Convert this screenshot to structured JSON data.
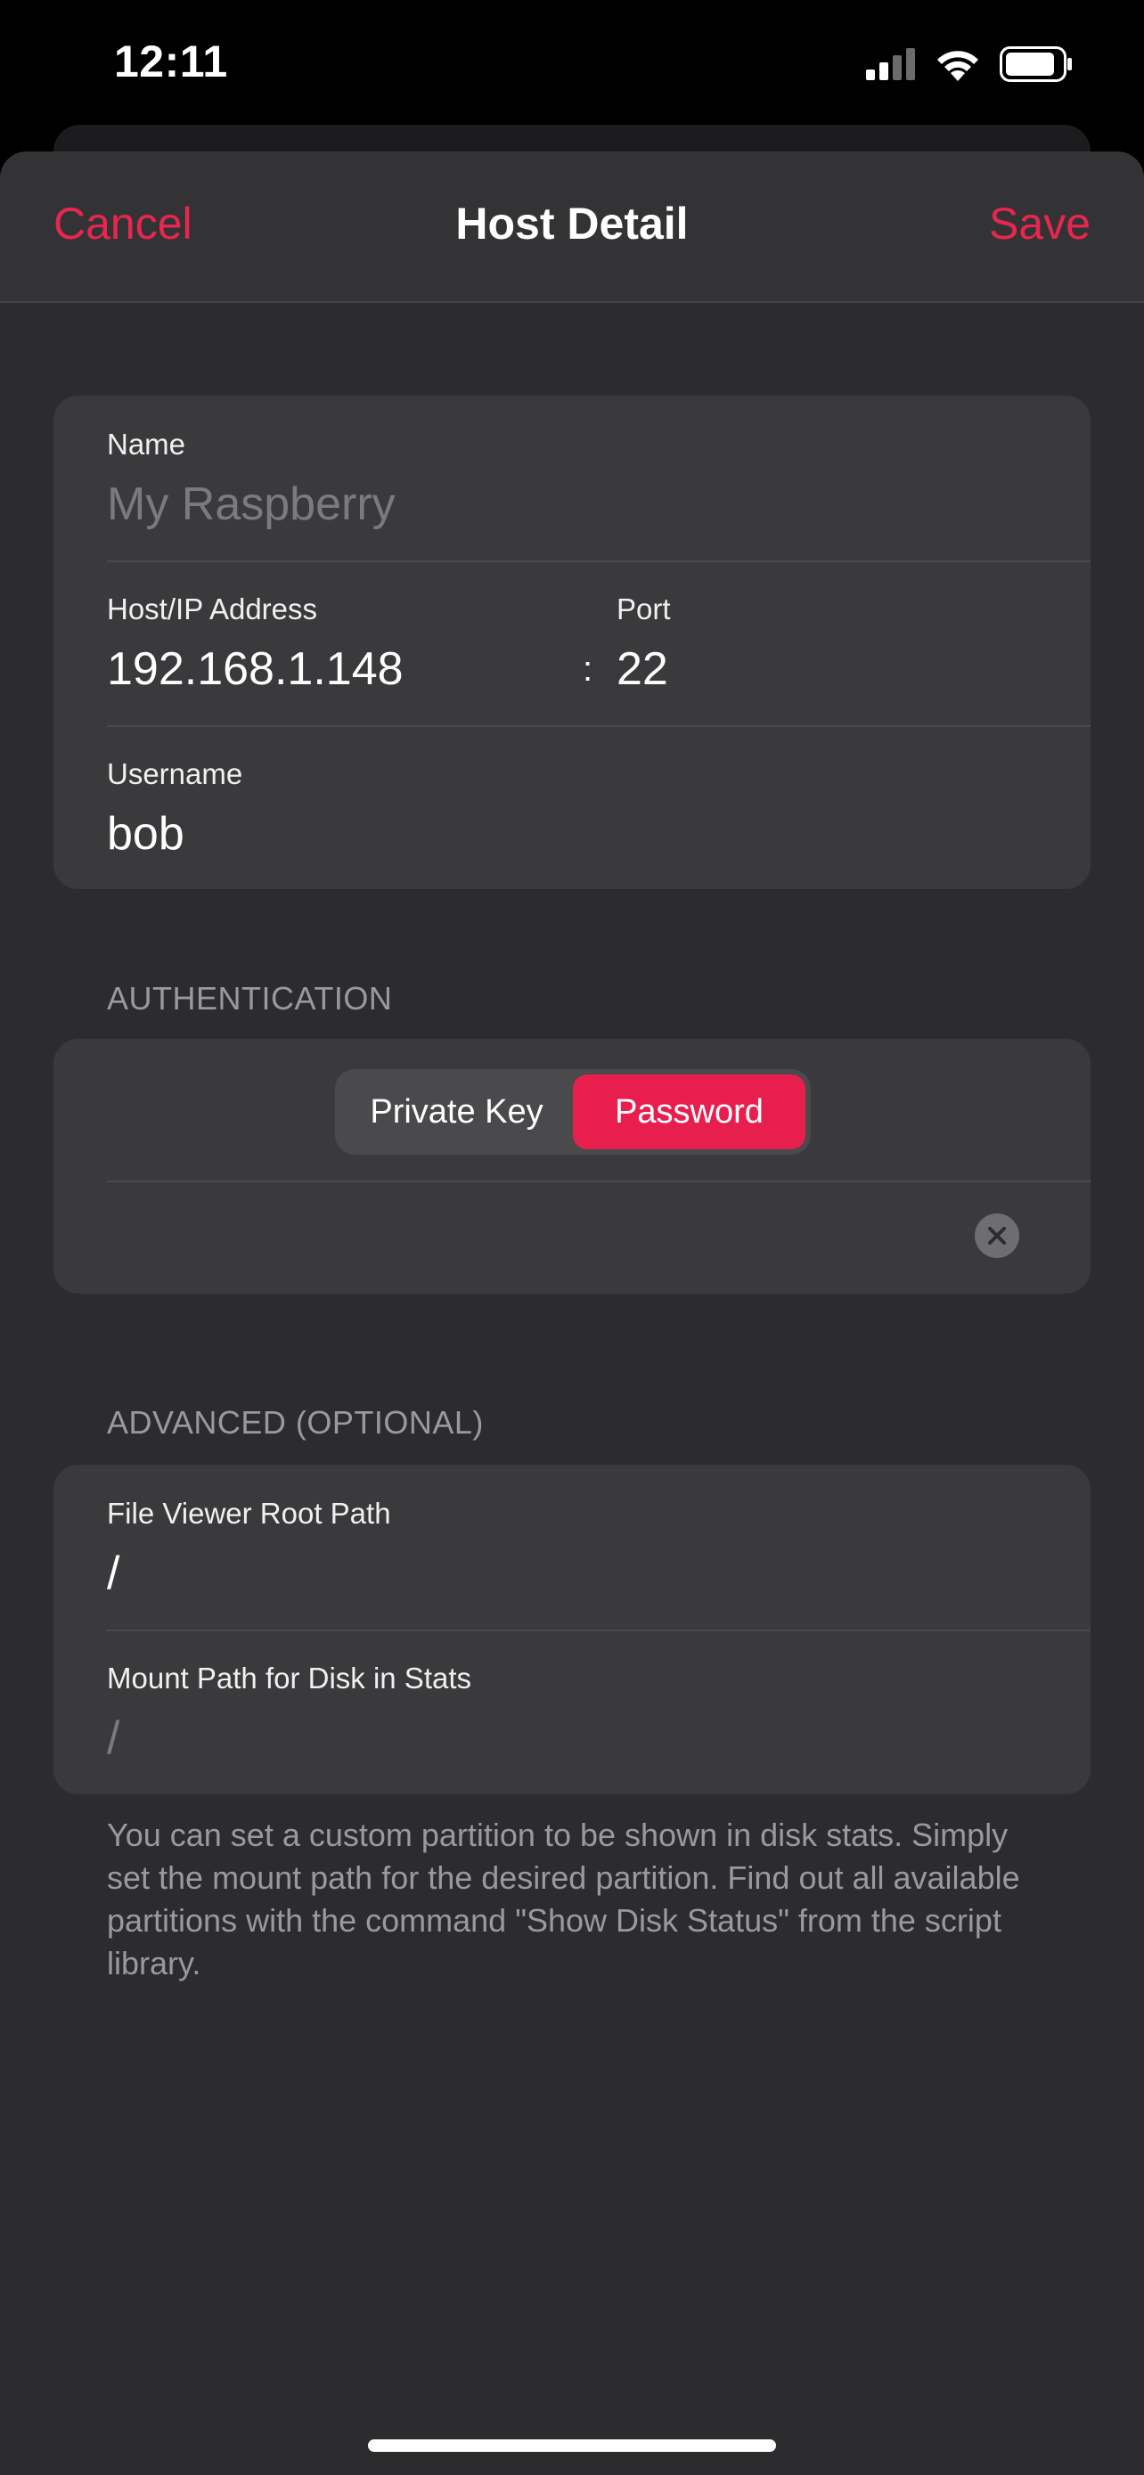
{
  "status_bar": {
    "time": "12:11"
  },
  "nav": {
    "cancel": "Cancel",
    "title": "Host Detail",
    "save": "Save"
  },
  "host": {
    "name_label": "Name",
    "name_placeholder": "My Raspberry",
    "host_label": "Host/IP Address",
    "host_value": "192.168.1.148",
    "colon": ":",
    "port_label": "Port",
    "port_value": "22",
    "username_label": "Username",
    "username_value": "bob"
  },
  "auth": {
    "header": "AUTHENTICATION",
    "options": [
      "Private Key",
      "Password"
    ],
    "selected": "Password"
  },
  "advanced": {
    "header": "ADVANCED (OPTIONAL)",
    "root_path_label": "File Viewer Root Path",
    "root_path_value": "/",
    "mount_path_label": "Mount Path for Disk in Stats",
    "mount_path_placeholder": "/",
    "footnote": "You can set a custom partition to be shown in disk stats. Simply set the mount path for the desired partition. Find out all available partitions with the command \"Show Disk Status\" from the script library."
  },
  "colors": {
    "accent": "#e8264f",
    "background": "#2c2c2e",
    "card": "#3a3a3c"
  }
}
